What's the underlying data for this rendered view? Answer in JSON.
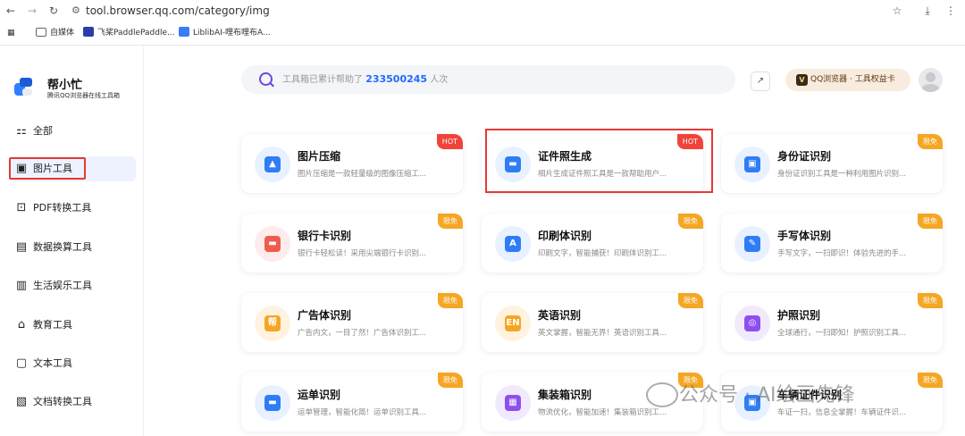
{
  "browser": {
    "url": "tool.browser.qq.com/category/img",
    "bookmarks": [
      "自媒体",
      "飞桨PaddlePaddle...",
      "LiblibAI-哩布哩布A..."
    ]
  },
  "sidebar": {
    "brand": "帮小忙",
    "tagline": "腾讯QQ浏览器在线工具箱",
    "items": [
      {
        "label": "全部",
        "icon": "grid-icon"
      },
      {
        "label": "图片工具",
        "icon": "image-icon"
      },
      {
        "label": "PDF转换工具",
        "icon": "pdf-icon"
      },
      {
        "label": "数据换算工具",
        "icon": "calculator-icon"
      },
      {
        "label": "生活娱乐工具",
        "icon": "calendar-icon"
      },
      {
        "label": "教育工具",
        "icon": "school-icon"
      },
      {
        "label": "文本工具",
        "icon": "text-icon"
      },
      {
        "label": "文档转换工具",
        "icon": "doc-icon"
      }
    ]
  },
  "header": {
    "search_prefix": "工具箱已累计帮助了",
    "search_count": "233500245",
    "search_suffix": "人次",
    "perk_label": "QQ浏览器 · 工具权益卡",
    "perk_icon_letter": "V"
  },
  "cards": [
    {
      "title": "图片压缩",
      "desc": "图片压缩是一款轻量级的图像压缩工...",
      "badge": "HOT",
      "icon_color": "#2f7df6",
      "icon_bg": "#e8f1ff"
    },
    {
      "title": "证件照生成",
      "desc": "相片生成证件照工具是一款帮助用户...",
      "badge": "HOT",
      "icon_color": "#2f7df6",
      "icon_bg": "#e8f1ff"
    },
    {
      "title": "身份证识别",
      "desc": "身份证识别工具是一种利用图片识别...",
      "badge": "限免",
      "icon_color": "#2f7df6",
      "icon_bg": "#e8f1ff"
    },
    {
      "title": "银行卡识别",
      "desc": "银行卡轻松读！采用尖端银行卡识别...",
      "badge": "限免",
      "icon_color": "#f05b4b",
      "icon_bg": "#fdeceb"
    },
    {
      "title": "印刷体识别",
      "desc": "印刷文字，智能捕获！印刷体识别工...",
      "badge": "限免",
      "icon_color": "#2f7df6",
      "icon_bg": "#e8f1ff"
    },
    {
      "title": "手写体识别",
      "desc": "手写文字，一扫即识！体验先进的手...",
      "badge": "限免",
      "icon_color": "#2f7df6",
      "icon_bg": "#e8f1ff"
    },
    {
      "title": "广告体识别",
      "desc": "广告内文，一目了然！广告体识别工...",
      "badge": "限免",
      "icon_color": "#f5a623",
      "icon_bg": "#fff3e0"
    },
    {
      "title": "英语识别",
      "desc": "英文掌握，智能无界！英语识别工具...",
      "badge": "限免",
      "icon_color": "#f5a623",
      "icon_bg": "#fff3e0"
    },
    {
      "title": "护照识别",
      "desc": "全球通行，一扫即知！护照识别工具...",
      "badge": "限免",
      "icon_color": "#8e4ff0",
      "icon_bg": "#f1eafd"
    },
    {
      "title": "运单识别",
      "desc": "运单管理，智能化简！运单识别工具...",
      "badge": "限免",
      "icon_color": "#2f7df6",
      "icon_bg": "#e8f1ff"
    },
    {
      "title": "集装箱识别",
      "desc": "物流优化，智能加速！集装箱识别工...",
      "badge": "限免",
      "icon_color": "#8e4ff0",
      "icon_bg": "#f1eafd"
    },
    {
      "title": "车辆证件识别",
      "desc": "车证一扫，信息全掌握！车辆证件识...",
      "badge": "限免",
      "icon_color": "#2f7df6",
      "icon_bg": "#e8f1ff"
    }
  ],
  "watermark": "公众号 · AI绘画先锋"
}
